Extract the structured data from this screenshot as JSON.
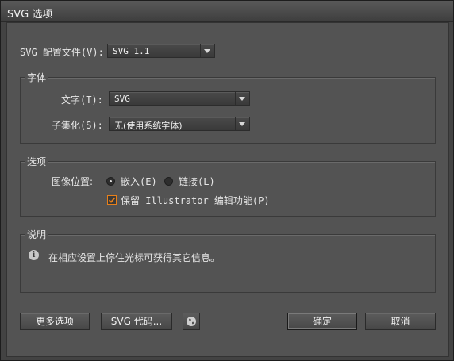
{
  "window": {
    "title": "SVG 选项"
  },
  "profile": {
    "label": "SVG 配置文件(V):",
    "value": "SVG 1.1"
  },
  "font_group": {
    "title": "字体",
    "type_label": "文字(T):",
    "type_value": "SVG",
    "subset_label": "子集化(S):",
    "subset_value": "无(使用系统字体)"
  },
  "options_group": {
    "title": "选项",
    "image_location_label": "图像位置:",
    "embed_label": "嵌入(E)",
    "link_label": "链接(L)",
    "embed_selected": true,
    "preserve_label": "保留 Illustrator 编辑功能(P)",
    "preserve_checked": true
  },
  "description_group": {
    "title": "说明",
    "text": "在相应设置上停住光标可获得其它信息。",
    "icon": "info-icon"
  },
  "buttons": {
    "more_options": "更多选项",
    "svg_code": "SVG 代码...",
    "globe_icon": "globe-icon",
    "ok": "确定",
    "cancel": "取消"
  },
  "colors": {
    "checkbox_accent": "#e8801a",
    "dialog_bg": "#535353"
  }
}
